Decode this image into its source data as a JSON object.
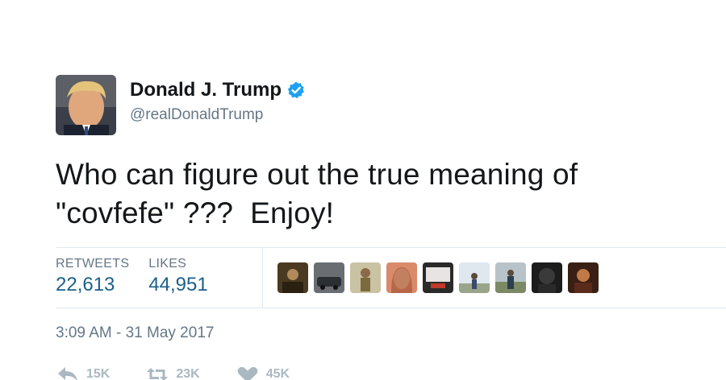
{
  "author": {
    "name": "Donald J. Trump",
    "handle": "@realDonaldTrump",
    "verified": true,
    "verified_color": "#1da1f2"
  },
  "tweet": {
    "text": "Who can figure out the true meaning of \"covfefe\" ???  Enjoy!"
  },
  "stats": {
    "retweets_label": "RETWEETS",
    "retweets_value": "22,613",
    "likes_label": "LIKES",
    "likes_value": "44,951",
    "liker_avatar_count": 9
  },
  "timestamp": "3:09 AM - 31 May 2017",
  "actions": {
    "reply_icon": "reply-icon",
    "reply_count": "15K",
    "retweet_icon": "retweet-icon",
    "retweet_count": "23K",
    "like_icon": "heart-icon",
    "like_count": "45K"
  },
  "colors": {
    "text": "#14171a",
    "secondary": "#657786",
    "stat_value": "#1b5f8a",
    "action": "#aab8c2",
    "divider": "#e1e8ed"
  }
}
